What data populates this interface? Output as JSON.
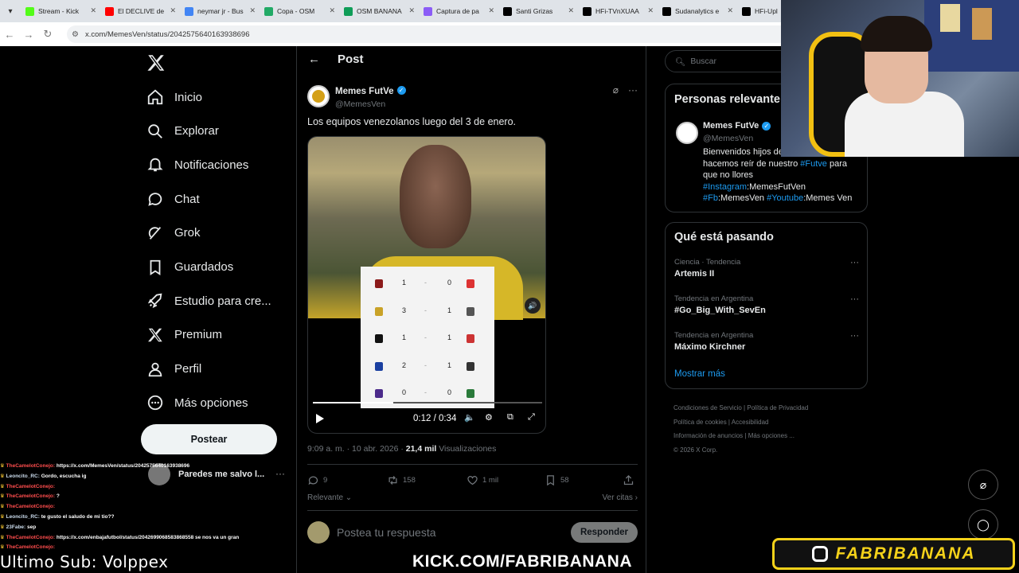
{
  "browser": {
    "tabs": [
      {
        "title": "Stream - Kick",
        "color": "#53fc18"
      },
      {
        "title": "El DECLIVE de",
        "color": "#ff0000"
      },
      {
        "title": "neymar jr - Bus",
        "color": "#4285f4"
      },
      {
        "title": "Copa - OSM",
        "color": "#2a6"
      },
      {
        "title": "OSM BANANA",
        "color": "#0f9d58"
      },
      {
        "title": "Captura de pa",
        "color": "#8b5cf6"
      },
      {
        "title": "Santi Grizas",
        "color": "#000000"
      },
      {
        "title": "HFi-TVnXUAA",
        "color": "#000000"
      },
      {
        "title": "Sudanalytics e",
        "color": "#000000"
      },
      {
        "title": "HFi-Upl",
        "color": "#000000"
      }
    ],
    "url": "x.com/MemesVen/status/2042575640163938696"
  },
  "nav": {
    "items": [
      {
        "label": "Inicio",
        "icon": "home-icon"
      },
      {
        "label": "Explorar",
        "icon": "search-icon"
      },
      {
        "label": "Notificaciones",
        "icon": "bell-icon"
      },
      {
        "label": "Chat",
        "icon": "chat-icon"
      },
      {
        "label": "Grok",
        "icon": "grok-icon"
      },
      {
        "label": "Guardados",
        "icon": "bookmark-icon"
      },
      {
        "label": "Estudio para cre...",
        "icon": "rocket-icon"
      },
      {
        "label": "Premium",
        "icon": "x-logo-icon"
      },
      {
        "label": "Perfil",
        "icon": "person-icon"
      },
      {
        "label": "Más opciones",
        "icon": "more-circle-icon"
      }
    ],
    "post_label": "Postear",
    "account_name": "Paredes me salvo l..."
  },
  "chat": [
    {
      "user": "TheCamelotConejo:",
      "msg": "https://x.com/MemesVen/status/2042575640163938696"
    },
    {
      "user": "Leoncito_RC:",
      "msg": "Gordo, escucha ig"
    },
    {
      "user": "TheCamelotConejo:",
      "msg": ""
    },
    {
      "user": "TheCamelotConejo:",
      "msg": "?"
    },
    {
      "user": "TheCamelotConejo:",
      "msg": ""
    },
    {
      "user": "Leoncito_RC:",
      "msg": "te gusto el saludo de mi tio??"
    },
    {
      "user": "23Fabe:",
      "msg": "sep"
    },
    {
      "user": "TheCamelotConejo:",
      "msg": "https://x.com/enbajafutbol/status/2042699068583868558 se nos va un grande"
    },
    {
      "user": "TheCamelotConejo:",
      "msg": ""
    }
  ],
  "last_sub": "Ultimo Sub: Volppex",
  "post": {
    "header": "Post",
    "author_name": "Memes FutVe",
    "author_handle": "@MemesVen",
    "text": "Los equipos venezolanos luego del 3 de enero.",
    "video_time": "0:12 / 0:34",
    "progress": 0.35,
    "timestamp": "9:09 a. m. · 10 abr. 2026 · ",
    "views": "21,4 mil",
    "views_label": " Visualizaciones",
    "replies": "9",
    "reposts": "158",
    "likes": "1 mil",
    "bookmarks": "58",
    "relevant_label": "Relevante",
    "quotes_label": "Ver citas",
    "reply_placeholder": "Postea tu respuesta",
    "reply_button": "Responder"
  },
  "results": [
    {
      "home": "1",
      "away": "0",
      "home_color": "#8b1a1a",
      "away_color": "#d33"
    },
    {
      "home": "3",
      "away": "1",
      "home_color": "#c9a227",
      "away_color": "#555"
    },
    {
      "home": "1",
      "away": "1",
      "home_color": "#111",
      "away_color": "#c33"
    },
    {
      "home": "2",
      "away": "1",
      "home_color": "#1a3fa0",
      "away_color": "#333"
    },
    {
      "home": "0",
      "away": "0",
      "home_color": "#4b2a8a",
      "away_color": "#2a7a3a"
    }
  ],
  "sidebar": {
    "search_placeholder": "Buscar",
    "relevant_title": "Personas relevante",
    "rel_name": "Memes FutVe",
    "rel_handle": "@MemesVen",
    "bio_1": "Bienvenidos hijos de L...",
    "bio_2": "hacemos reír de nuestro ",
    "bio_tag1": "#Futve",
    "bio_3": " para que no llores",
    "bio_tag2": "#Instagram",
    "bio_4": ":MemesFutVen",
    "bio_tag3": "#Fb",
    "bio_5": ":MemesVen ",
    "bio_tag4": "#Youtube",
    "bio_6": ":Memes Ven",
    "trends_title": "Qué está pasando",
    "trends": [
      {
        "context": "Ciencia · Tendencia",
        "name": "Artemis II"
      },
      {
        "context": "Tendencia en Argentina",
        "name": "#Go_Big_With_SevEn"
      },
      {
        "context": "Tendencia en Argentina",
        "name": "Máximo Kirchner"
      }
    ],
    "show_more": "Mostrar más",
    "footer": [
      "Condiciones de Servicio",
      "Política de Privacidad",
      "Política de cookies",
      "Accesibilidad",
      "Información de anuncios",
      "Más opciones ...",
      "© 2026 X Corp."
    ]
  },
  "overlay": {
    "kick_text": "KICK.COM/FABRIBANANA",
    "brand_text": "FABRIBANANA"
  }
}
